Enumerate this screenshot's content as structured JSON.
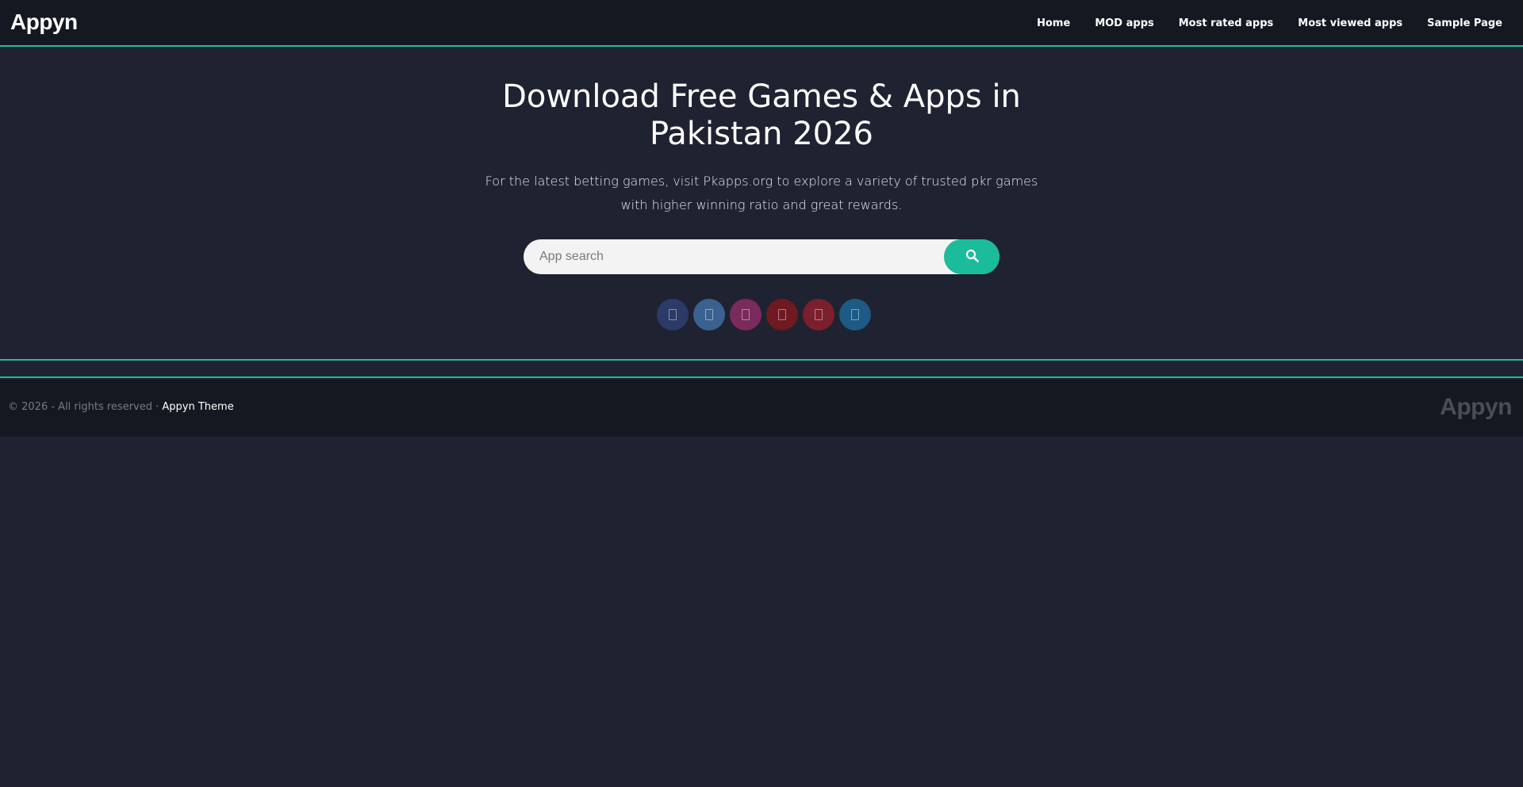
{
  "header": {
    "logo": "Appyn",
    "nav": [
      {
        "label": "Home"
      },
      {
        "label": "MOD apps"
      },
      {
        "label": "Most rated apps"
      },
      {
        "label": "Most viewed apps"
      },
      {
        "label": "Sample Page"
      }
    ]
  },
  "hero": {
    "title_line1": "Download Free Games & Apps in",
    "title_line2": "Pakistan 2026",
    "subtitle": "For the latest betting games, visit Pkapps.org to explore a variety of trusted pkr games with higher winning ratio and great rewards."
  },
  "search": {
    "placeholder": "App search",
    "value": "",
    "button_icon": "search-icon"
  },
  "social": [
    {
      "name": "facebook",
      "icon": "facebook-icon",
      "color": "#2b3a67"
    },
    {
      "name": "twitter",
      "icon": "twitter-icon",
      "color": "#3a6190"
    },
    {
      "name": "instagram",
      "icon": "instagram-icon",
      "color": "#7a2a5c"
    },
    {
      "name": "youtube",
      "icon": "youtube-icon",
      "color": "#6f1920"
    },
    {
      "name": "pinterest",
      "icon": "pinterest-icon",
      "color": "#7c1f2c"
    },
    {
      "name": "telegram",
      "icon": "telegram-icon",
      "color": "#1d5a85"
    }
  ],
  "footer": {
    "copyright": "© 2026 - All rights reserved · ",
    "theme_link": "Appyn Theme",
    "logo": "Appyn"
  },
  "colors": {
    "accent": "#1bbc9b",
    "header_bg": "#141820",
    "page_bg": "#1f2230"
  }
}
